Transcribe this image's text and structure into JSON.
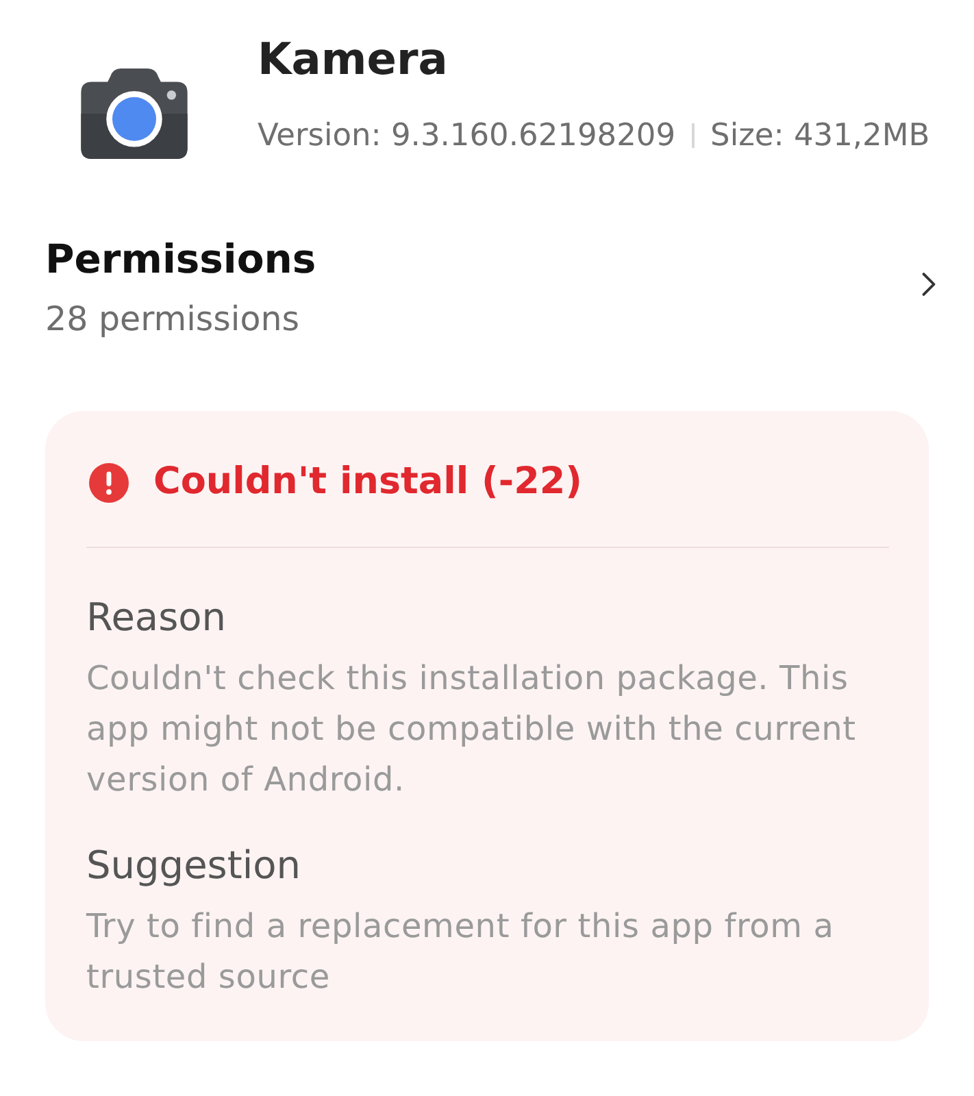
{
  "app": {
    "name": "Kamera",
    "version": "Version: 9.3.160.62198209",
    "size": "Size: 431,2MB"
  },
  "permissions": {
    "title": "Permissions",
    "count": "28 permissions"
  },
  "error": {
    "title": "Couldn't install (-22)",
    "sections": [
      {
        "heading": "Reason",
        "text": "Couldn't check this installation package. This app might not be compatible with the current version of Android."
      },
      {
        "heading": "Suggestion",
        "text": "Try to find a replacement for this app from a trusted source"
      }
    ]
  }
}
